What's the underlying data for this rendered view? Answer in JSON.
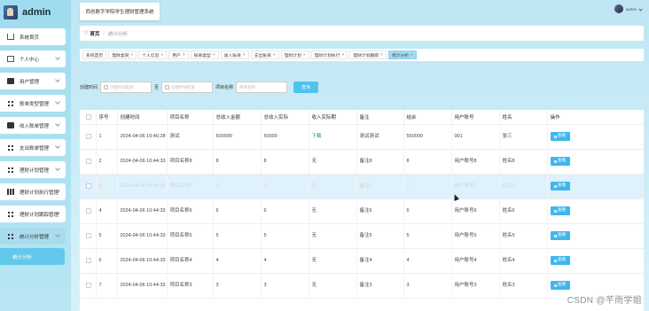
{
  "app": {
    "name": "admin",
    "system_title": "西创数字学院学生理财管理系统",
    "user_name": "admin"
  },
  "sidebar": {
    "items": [
      {
        "label": "系统首页",
        "icon": "home-icon",
        "expandable": false
      },
      {
        "label": "个人中心",
        "icon": "box-icon",
        "expandable": true
      },
      {
        "label": "用户管理",
        "icon": "user-icon",
        "expandable": true
      },
      {
        "label": "账单类型管理",
        "icon": "grid-icon",
        "expandable": true
      },
      {
        "label": "收入账单管理",
        "icon": "solid-icon",
        "expandable": true
      },
      {
        "label": "支出账单管理",
        "icon": "grid-icon",
        "expandable": true
      },
      {
        "label": "理财计划管理",
        "icon": "grid-icon",
        "expandable": true
      },
      {
        "label": "理财计划执行管理",
        "icon": "bars-icon",
        "expandable": true
      },
      {
        "label": "理财计划跟踪管理",
        "icon": "grid-icon",
        "expandable": true
      },
      {
        "label": "统计分析管理",
        "icon": "grid-icon",
        "expandable": true
      }
    ],
    "submenu_active": "统计分析"
  },
  "breadcrumb": {
    "home": "首页",
    "current": "统计分析"
  },
  "tabs": [
    {
      "label": "系统首页",
      "closable": false,
      "active": false
    },
    {
      "label": "理财类同",
      "closable": true,
      "active": false
    },
    {
      "label": "个人信息",
      "closable": true,
      "active": false
    },
    {
      "label": "用户",
      "closable": true,
      "active": false
    },
    {
      "label": "账单类型",
      "closable": true,
      "active": false
    },
    {
      "label": "收入账单",
      "closable": true,
      "active": false
    },
    {
      "label": "支出账单",
      "closable": true,
      "active": false
    },
    {
      "label": "理财计划",
      "closable": true,
      "active": false
    },
    {
      "label": "理财计划执行",
      "closable": true,
      "active": false
    },
    {
      "label": "理财计划跟踪",
      "closable": true,
      "active": false
    },
    {
      "label": "统计分析",
      "closable": true,
      "active": true
    }
  ],
  "search": {
    "created_label": "创建时间",
    "start_placeholder": "创建时间起始",
    "to_label": "至",
    "end_placeholder": "创建时间结束",
    "name_label": "项目名称",
    "name_placeholder": "项目名称",
    "button": "查询"
  },
  "table": {
    "columns": [
      "",
      "序号",
      "创建时间",
      "项目名称",
      "总收入金额",
      "总收入实际",
      "收入实际期",
      "备注",
      "结余",
      "用户账号",
      "姓名",
      "操作"
    ],
    "view_label": "查看",
    "rows": [
      {
        "no": "1",
        "created": "2024-04-06 10:46:28",
        "name": "测试",
        "total_income": "600000",
        "actual_income": "50000",
        "period": "下载",
        "remark": "测试测试",
        "balance": "550000",
        "account": "001",
        "person": "张三",
        "highlight": false
      },
      {
        "no": "2",
        "created": "2024-04-06 10:44:33",
        "name": "项目名称8",
        "total_income": "8",
        "actual_income": "8",
        "period": "无",
        "remark": "备注8",
        "balance": "8",
        "account": "用户账号8",
        "person": "姓名8",
        "highlight": false
      },
      {
        "no": "3",
        "created": "2024-04-06 10:44:33",
        "name": "项目名称7",
        "total_income": "7",
        "actual_income": "7",
        "period": "无",
        "remark": "备注7",
        "balance": "7",
        "account": "用户账号7",
        "person": "姓名7",
        "highlight": true
      },
      {
        "no": "4",
        "created": "2024-04-06 10:44:33",
        "name": "项目名称6",
        "total_income": "6",
        "actual_income": "6",
        "period": "无",
        "remark": "备注6",
        "balance": "6",
        "account": "用户账号6",
        "person": "姓名6",
        "highlight": false
      },
      {
        "no": "5",
        "created": "2024-04-06 10:44:33",
        "name": "项目名称5",
        "total_income": "5",
        "actual_income": "5",
        "period": "无",
        "remark": "备注5",
        "balance": "5",
        "account": "用户账号5",
        "person": "姓名5",
        "highlight": false
      },
      {
        "no": "6",
        "created": "2024-04-06 10:44:33",
        "name": "项目名称4",
        "total_income": "4",
        "actual_income": "4",
        "period": "无",
        "remark": "备注4",
        "balance": "4",
        "account": "用户账号4",
        "person": "姓名4",
        "highlight": false
      },
      {
        "no": "7",
        "created": "2024-04-06 10:44:33",
        "name": "项目名称3",
        "total_income": "3",
        "actual_income": "3",
        "period": "无",
        "remark": "备注3",
        "balance": "3",
        "account": "用户账号3",
        "person": "姓名3",
        "highlight": false
      }
    ]
  },
  "watermark": "CSDN @芊雨学姐",
  "colors": {
    "accent": "#4fc3ef",
    "sidebar": "#9fdcef",
    "active_tab": "#a5dbf0",
    "highlight_row": "#dff1fb",
    "submenu_active": "#62c8ec"
  }
}
